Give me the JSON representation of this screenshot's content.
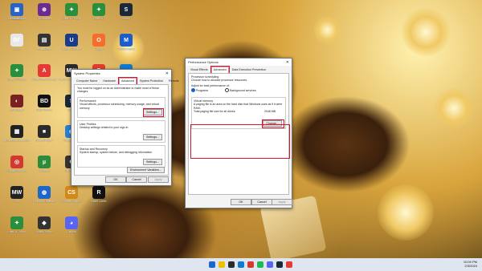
{
  "desktop": {
    "icons": [
      {
        "label": "I'm Pretty...",
        "color": "#333333",
        "glyph": "📁"
      },
      {
        "label": "BFE",
        "color": "#e8e8e8",
        "glyph": "BF"
      },
      {
        "label": "Enter 3D Photo",
        "color": "#2a8f3c",
        "glyph": "✦"
      },
      {
        "label": "Im Browser",
        "color": "#7a1f22",
        "glyph": "◐"
      },
      {
        "label": "Im Minecraft Launcher",
        "color": "#222222",
        "glyph": "▦"
      },
      {
        "label": "Google Chrome",
        "color": "#d33a2f",
        "glyph": "◎"
      },
      {
        "label": "MW",
        "color": "#222222",
        "glyph": "MW"
      },
      {
        "label": "Enter 3D Photo",
        "color": "#2a8f3c",
        "glyph": "✦"
      },
      {
        "label": "Tor Browser",
        "color": "#6b2c91",
        "glyph": "⊕"
      },
      {
        "label": "reinstall.exe",
        "color": "#333333",
        "glyph": "▤"
      },
      {
        "label": "Avast Free Antivirus",
        "color": "#e53935",
        "glyph": "A"
      },
      {
        "label": "Black Desert",
        "color": "#111111",
        "glyph": "BD"
      },
      {
        "label": "Roblox Player",
        "color": "#2b2b2b",
        "glyph": "■"
      },
      {
        "label": "uTorrent",
        "color": "#2e8b3a",
        "glyph": "µ"
      },
      {
        "label": "Windows Defender",
        "color": "#1e66c8",
        "glyph": "◍"
      },
      {
        "label": "Roblox Studio",
        "color": "#333333",
        "glyph": "◆"
      },
      {
        "label": "Enter 3D Photo",
        "color": "#2a8f3c",
        "glyph": "✦"
      },
      {
        "label": "Ubisoft Connect",
        "color": "#1a3a8a",
        "glyph": "U"
      },
      {
        "label": "Call of Duty Warzone",
        "color": "#2b2b2b",
        "glyph": "MW"
      },
      {
        "label": "Steam",
        "color": "#1b2838",
        "glyph": "S"
      },
      {
        "label": "Google Earth",
        "color": "#2a7fd4",
        "glyph": "◉"
      },
      {
        "label": "Call of Duty",
        "color": "#333333",
        "glyph": "C"
      },
      {
        "label": "Counter-Strike 2",
        "color": "#d18a19",
        "glyph": "CS"
      },
      {
        "label": "Discord",
        "color": "#5865f2",
        "glyph": "◕"
      },
      {
        "label": "Enter 3D",
        "color": "#2a8f3c",
        "glyph": "✦"
      },
      {
        "label": "Origin",
        "color": "#f56c2d",
        "glyph": "O"
      },
      {
        "label": "Roblox",
        "color": "#e33b2e",
        "glyph": "R"
      },
      {
        "label": "EA",
        "color": "#d32f2f",
        "glyph": "EA"
      },
      {
        "label": "Counter-Strike",
        "color": "#e69a1b",
        "glyph": "CS"
      },
      {
        "label": "Steam",
        "color": "#1b2838",
        "glyph": "S"
      },
      {
        "label": "Razer Cortex",
        "color": "#111111",
        "glyph": "R"
      },
      {
        "label": "Steam",
        "color": "#1b2838",
        "glyph": "S"
      },
      {
        "label": "Malwarebytes",
        "color": "#1d5dc9",
        "glyph": "M"
      },
      {
        "label": "Microsoft Edge",
        "color": "#0f7bd1",
        "glyph": "e"
      },
      {
        "label": "Steam",
        "color": "#1b2838",
        "glyph": "S"
      },
      {
        "label": "Razer Synapse",
        "color": "#1c1c1c",
        "glyph": "R"
      },
      {
        "label": "Spotify",
        "color": "#1db954",
        "glyph": "♫"
      },
      {
        "label": "Microsoft Store",
        "color": "#2a63c6",
        "glyph": "▣"
      }
    ]
  },
  "system_properties": {
    "title": "System Properties",
    "close": "✕",
    "tabs": [
      "Computer Name",
      "Hardware",
      "Advanced",
      "System Protection",
      "Remote"
    ],
    "admin_note": "You must be logged on as an Administrator to make most of these changes.",
    "performance": {
      "title": "Performance",
      "desc": "Visual effects, processor scheduling, memory usage, and virtual memory",
      "button": "Settings..."
    },
    "user_profiles": {
      "title": "User Profiles",
      "desc": "Desktop settings related to your sign-in",
      "button": "Settings..."
    },
    "startup": {
      "title": "Startup and Recovery",
      "desc": "System startup, system failure, and debugging information",
      "button": "Settings..."
    },
    "env_button": "Environment Variables...",
    "ok": "OK",
    "cancel": "Cancel",
    "apply": "Apply"
  },
  "performance_options": {
    "title": "Performance Options",
    "close": "✕",
    "tabs": [
      "Visual Effects",
      "Advanced",
      "Data Execution Prevention"
    ],
    "proc_title": "Processor scheduling",
    "proc_desc": "Choose how to allocate processor resources.",
    "adjust_label": "Adjust for best performance of:",
    "radio_programs": "Programs",
    "radio_background": "Background services",
    "vm_title": "Virtual memory",
    "vm_desc": "A paging file is an area on the hard disk that Windows uses as if it were RAM.",
    "vm_total_label": "Total paging file size for all drives:",
    "vm_total_value": "2048 MB",
    "change_button": "Change...",
    "ok": "OK",
    "cancel": "Cancel",
    "apply": "Apply"
  },
  "taskbar": {
    "time": "10:00 PM",
    "date": "2/3/2024",
    "icon_colors": [
      "#1e66c8",
      "#f0c000",
      "#2b2b2b",
      "#0f7bd1",
      "#d33a2f",
      "#1db954",
      "#5865f2",
      "#1b2838",
      "#e53935"
    ]
  }
}
